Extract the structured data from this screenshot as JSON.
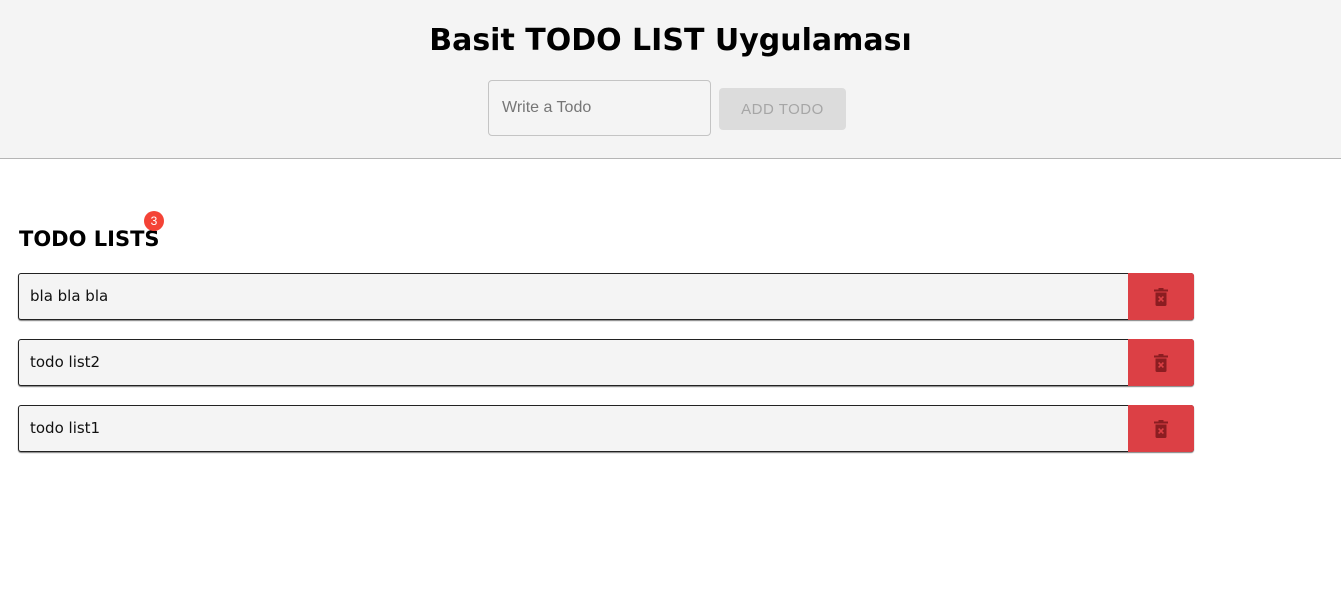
{
  "header": {
    "title": "Basit TODO LIST Uygulaması",
    "input_placeholder": "Write a Todo",
    "input_value": "",
    "add_button_label": "ADD TODO"
  },
  "list": {
    "heading": "TODO LISTS",
    "count": "3",
    "items": [
      {
        "text": "bla bla bla"
      },
      {
        "text": "todo list2"
      },
      {
        "text": "todo list1"
      }
    ]
  },
  "icons": {
    "delete": "trash-icon"
  },
  "colors": {
    "header_bg": "#f4f4f4",
    "badge": "#f44336",
    "delete_button": "#dc4045",
    "delete_icon": "#8b1d21",
    "add_button_bg": "#dcdcdc",
    "add_button_text": "#a6a6a6"
  }
}
